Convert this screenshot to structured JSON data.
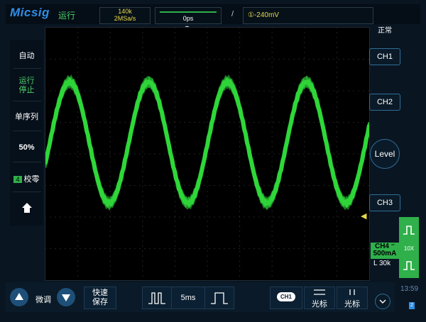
{
  "brand": "Micsig",
  "run_state": "运行",
  "timebase": {
    "sample_points": "140k",
    "sample_rate": "2MSa/s",
    "offset": "0ps"
  },
  "trigger": {
    "slope_symbol": "/",
    "level_text": "①-240mV",
    "mode": "正常"
  },
  "left_panel": {
    "auto": "自动",
    "run_line1": "运行",
    "run_line2": "停止",
    "single": "单序列",
    "percent": "50%",
    "zero_badge": "4",
    "zero": "校零"
  },
  "right_panel": {
    "ch1": "CH1",
    "ch2": "CH2",
    "level": "Level",
    "ch3": "CH3",
    "ch4_line1": "CH4 ⁻",
    "ch4_line2": "500mA",
    "length": "L 30k",
    "probe": "10X"
  },
  "bottom_bar": {
    "fine_adjust": "微调",
    "quick_save_line1": "快速",
    "quick_save_line2": "保存",
    "timebase_value": "5ms",
    "cursor_ch_badge": "CH1",
    "cursor_label1": "光标",
    "cursor_label2": "光标"
  },
  "status": {
    "time": "13:59",
    "battery": "2"
  },
  "colors": {
    "trace": "#2fd83a",
    "accent": "#2f8ee8",
    "trigger": "#e8d84a"
  },
  "waveform": {
    "channel": "CH4",
    "cycles_visible": 4.1
  }
}
